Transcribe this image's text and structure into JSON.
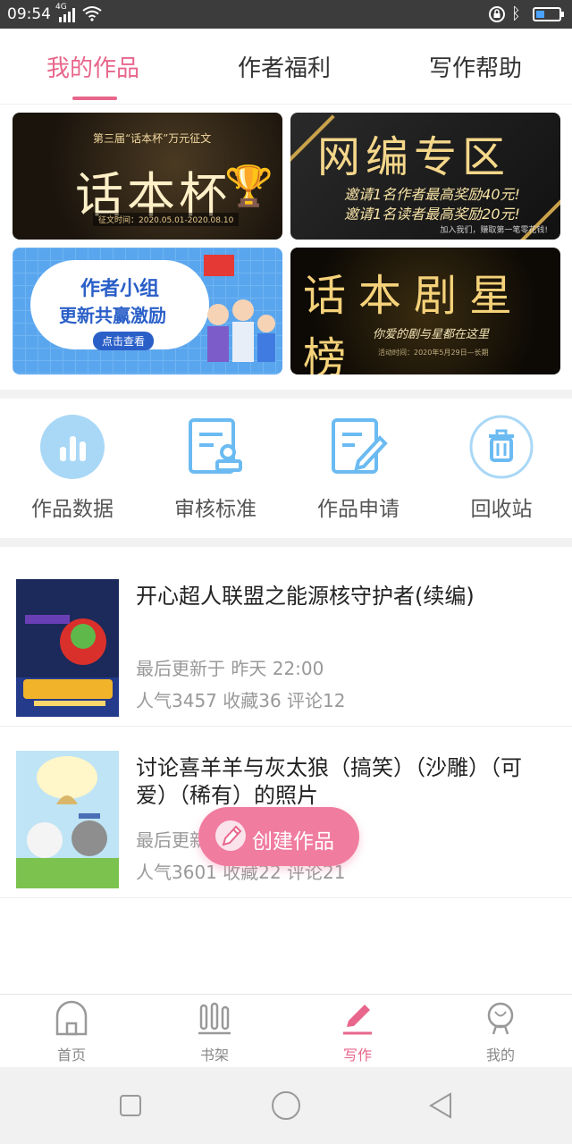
{
  "status_bar": {
    "time": "09:54",
    "network": "4G"
  },
  "tabs": [
    {
      "label": "我的作品",
      "active": true
    },
    {
      "label": "作者福利",
      "active": false
    },
    {
      "label": "写作帮助",
      "active": false
    }
  ],
  "banners": {
    "b1": {
      "subtitle": "第三届“话本杯”万元征文",
      "title": "话本杯",
      "date": "征文时间：2020.05.01-2020.08.10"
    },
    "b2": {
      "title": "网编专区",
      "line1": "邀请1名作者最高奖励40元!",
      "line2": "邀请1名读者最高奖励20元!",
      "foot": "加入我们，赚取第一笔零花钱!"
    },
    "b3": {
      "line1": "作者小组",
      "line2": "更新共赢激励",
      "button": "点击查看"
    },
    "b4": {
      "title": "话本剧星榜",
      "line1": "你爱的剧与星都在这里",
      "foot": "活动时间：2020年5月29日—长期"
    }
  },
  "shortcuts": [
    {
      "label": "作品数据",
      "icon": "bar-chart-icon"
    },
    {
      "label": "审核标准",
      "icon": "review-standard-icon"
    },
    {
      "label": "作品申请",
      "icon": "apply-edit-icon"
    },
    {
      "label": "回收站",
      "icon": "trash-icon"
    }
  ],
  "works": [
    {
      "title": "开心超人联盟之能源核守护者(续编)",
      "updated": "最后更新于 昨天 22:00",
      "stats": "人气3457 收藏36 评论12"
    },
    {
      "title": "讨论喜羊羊与灰太狼（搞笑）（沙雕）（可爱）（稀有）的照片",
      "updated": "最后更新于 昨天 22:00",
      "stats": "人气3601 收藏22 评论21"
    }
  ],
  "fab": {
    "label": "创建作品",
    "icon": "pencil-icon"
  },
  "bottom_nav": [
    {
      "label": "首页",
      "icon": "home-icon",
      "active": false
    },
    {
      "label": "书架",
      "icon": "bookshelf-icon",
      "active": false
    },
    {
      "label": "写作",
      "icon": "write-icon",
      "active": true
    },
    {
      "label": "我的",
      "icon": "profile-icon",
      "active": false
    }
  ],
  "colors": {
    "accent": "#e8668b",
    "fab": "#f07ca0",
    "icon_blue": "#6bbbf2",
    "text_gray": "#999999"
  }
}
